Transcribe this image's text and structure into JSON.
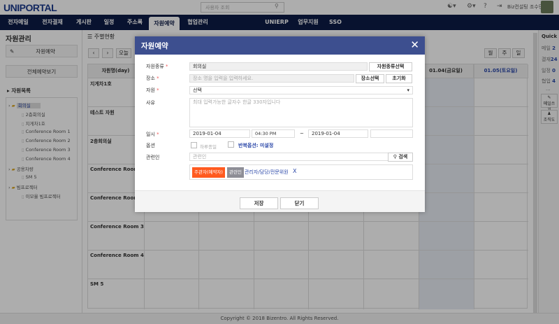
{
  "header": {
    "logo": "UNIPORTAL",
    "search_placeholder": "사용자 조회",
    "user": "Biz컨설팅 조수민",
    "icons": [
      "flag-korea-icon",
      "gear-icon",
      "help-icon",
      "logout-icon"
    ]
  },
  "nav": {
    "tabs": [
      "전자메일",
      "전자결재",
      "게시판",
      "일정",
      "주소록",
      "자원예약",
      "협업관리"
    ],
    "active": "자원예약",
    "right_tabs": [
      "UNIERP",
      "업무지원",
      "SSO"
    ]
  },
  "left": {
    "title": "자원관리",
    "reserve_btn": "자원예약",
    "all_btn": "전체예약보기",
    "list_title": "자원목록",
    "tree": [
      {
        "folder": "회의실",
        "items": [
          "2층회의실",
          "지게차1호",
          "Conference Room 1",
          "Conference Room 2",
          "Conference Room 3",
          "Conference Room 4"
        ]
      },
      {
        "folder": "공용차량",
        "items": [
          "SM 5"
        ]
      },
      {
        "folder": "빔프로젝터",
        "items": [
          "이모율 빔프로젝터"
        ]
      }
    ]
  },
  "main": {
    "title": "주별현황",
    "today": "오늘",
    "views": [
      "월",
      "주",
      "일"
    ],
    "name_header": "자원명(day)",
    "date_headers": [
      "",
      "",
      "",
      "",
      "",
      "01.04(금요일)",
      "01.05(토요일)"
    ],
    "rows": [
      "지게차1호",
      "테스트 자원",
      "2층회의실",
      "Conference Room 1",
      "Conference Room 2",
      "Conference Room 3",
      "Conference Room 4",
      "SM 5"
    ]
  },
  "quick": {
    "title": "Quick",
    "items": [
      {
        "label": "메일",
        "count": "2"
      },
      {
        "label": "결재",
        "count": "24"
      },
      {
        "label": "일정",
        "count": "0"
      },
      {
        "label": "협업",
        "count": "4"
      }
    ],
    "more": "...",
    "buttons": [
      "메일쓰기",
      "조직도"
    ]
  },
  "footer": "Copyright © 2018 Bizentro. All Rights Reserved.",
  "modal": {
    "title": "자원예약",
    "labels": {
      "type": "자원종류",
      "place": "장소",
      "resource": "자원",
      "reason": "사유",
      "datetime": "일시",
      "option": "옵션",
      "related": "관련인"
    },
    "type_value": "회의실",
    "type_btn": "자원종류선택",
    "place_placeholder": "장소 명을 입력을 입력하세요.",
    "place_btn": "장소선택",
    "reset_btn": "초기화",
    "resource_value": "선택",
    "reason_placeholder": "최대 입력가능한 글자수 한글 330자입니다",
    "start_date": "2019-01-04",
    "start_time": "04:30 PM",
    "tilde": "~",
    "end_date": "2019-01-04",
    "end_time": "",
    "allday": "하루종일",
    "allday_checked": false,
    "repeat_checked": false,
    "repeat": "반복옵션: 미설정",
    "related_placeholder": "관련인",
    "search_btn": "검색",
    "tag_owner": "주관자(예약자)",
    "tag_related": "관련인",
    "related_person": "관리자/담당/전문위원",
    "remove": "X",
    "save": "저장",
    "close": "닫기"
  },
  "colors": {
    "nav": "#0c1b46",
    "modal_header": "#3d4f8f",
    "owner_tag": "#ff5a1f",
    "link": "#2a47a8"
  }
}
